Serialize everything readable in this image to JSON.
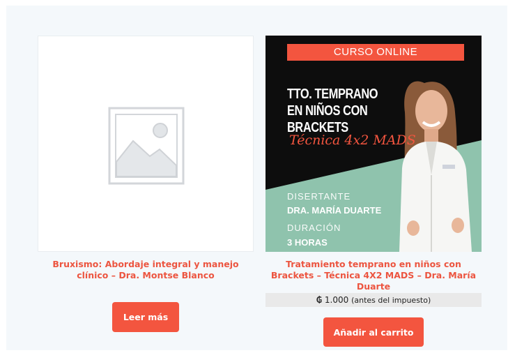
{
  "products": [
    {
      "title": "Bruxismo: Abordaje integral y manejo clínico – Dra. Montse Blanco",
      "image": "placeholder-image-icon",
      "button_label": "Leer más"
    },
    {
      "title": "Tratamiento temprano en niños con Brackets – Técnica 4X2 MADS – Dra. María Duarte",
      "image": {
        "badge": "CURSO ONLINE",
        "headline": "TTO. TEMPRANO EN NIÑOS CON BRACKETS",
        "technique": "Técnica 4x2 MADS",
        "speaker_label": "DISERTANTE",
        "speaker_name": "DRA. MARÍA DUARTE",
        "duration_label": "DURACIÓN",
        "duration_value": "3 HORAS"
      },
      "price": {
        "currency": "₲",
        "amount": "1.000",
        "tax_note": "(antes del impuesto)"
      },
      "button_label": "Añadir al carrito"
    }
  ],
  "colors": {
    "accent": "#f3553f",
    "title": "#ec5540",
    "panel_bg": "#f4f8fb",
    "promo_dark": "#0d0d0d",
    "promo_teal": "#8fc3ad"
  }
}
